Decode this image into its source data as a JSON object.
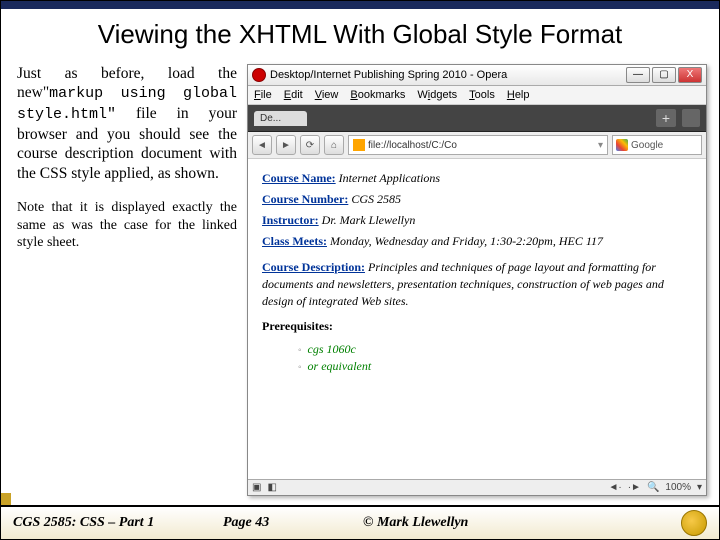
{
  "slide": {
    "title": "Viewing the XHTML With Global Style Format",
    "para1_a": "Just as before, load the new\"",
    "para1_code": "markup using global style.html\"",
    "para1_b": " file in your browser and you should see the course description document with the CSS style applied, as shown.",
    "para2": "Note that it is displayed exactly the same as was the case for the linked style sheet."
  },
  "browser": {
    "window_title": "Desktop/Internet Publishing Spring 2010 - Opera",
    "menu": [
      "File",
      "Edit",
      "View",
      "Bookmarks",
      "Widgets",
      "Tools",
      "Help"
    ],
    "tab_label": "De...",
    "address": "file://localhost/C:/Co",
    "search_placeholder": "Google",
    "zoom": "100%",
    "win_min": "—",
    "win_max": "▢",
    "win_close": "X"
  },
  "page": {
    "fields": {
      "course_name_label": "Course Name:",
      "course_name": "Internet Applications",
      "course_number_label": "Course Number:",
      "course_number": "CGS 2585",
      "instructor_label": "Instructor:",
      "instructor": "Dr. Mark Llewellyn",
      "class_meets_label": "Class Meets:",
      "class_meets": "Monday, Wednesday and Friday, 1:30-2:20pm, HEC 117",
      "description_label": "Course Description:",
      "description": "Principles and techniques of page layout and formatting for documents and newsletters, presentation techniques, construction of web pages and design of integrated Web sites.",
      "prereq_label": "Prerequisites:"
    },
    "prereqs": [
      "cgs 1060c",
      "or equivalent"
    ]
  },
  "footer": {
    "course": "CGS 2585: CSS – Part 1",
    "page": "Page 43",
    "copyright": "© Mark Llewellyn"
  }
}
